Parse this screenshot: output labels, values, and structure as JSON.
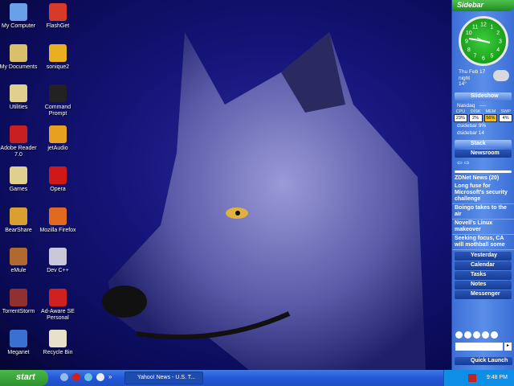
{
  "desktop": {
    "icons": [
      {
        "label": "My Computer",
        "color": "#6aa0e8"
      },
      {
        "label": "FlashGet",
        "color": "#d83a2a"
      },
      {
        "label": "My Documents",
        "color": "#d9c06a"
      },
      {
        "label": "sonique2",
        "color": "#e8b020"
      },
      {
        "label": "Utilities",
        "color": "#e0d090"
      },
      {
        "label": "Command Prompt",
        "color": "#222222"
      },
      {
        "label": "Adobe Reader 7.0",
        "color": "#c82020"
      },
      {
        "label": "jetAudio",
        "color": "#e8a020"
      },
      {
        "label": "Games",
        "color": "#e0d090"
      },
      {
        "label": "Opera",
        "color": "#d01818"
      },
      {
        "label": "BearShare",
        "color": "#d8a030"
      },
      {
        "label": "Mozilla Firefox",
        "color": "#e06a20"
      },
      {
        "label": "eMule",
        "color": "#b06a30"
      },
      {
        "label": "Dev C++",
        "color": "#c8c8d8"
      },
      {
        "label": "TorrentStorm",
        "color": "#903030"
      },
      {
        "label": "Ad-Aware SE Personal",
        "color": "#d02020"
      },
      {
        "label": "Meganet",
        "color": "#3a70d0"
      },
      {
        "label": "Recycle Bin",
        "color": "#e8e0c8"
      }
    ]
  },
  "sidebar": {
    "title": "Sidebar",
    "clock_numbers": [
      "12",
      "1",
      "2",
      "3",
      "4",
      "5",
      "6",
      "7",
      "8",
      "9",
      "10",
      "11"
    ],
    "weather": {
      "date": "Thu Feb 17",
      "period": "night",
      "temp": "14°"
    },
    "slideshow": "Slideshow",
    "stock": {
      "name": "Nasdaq",
      "value": "----"
    },
    "meters": [
      {
        "label": "CPU",
        "value": "23%"
      },
      {
        "label": "DISK",
        "value": "2%"
      },
      {
        "label": "MEM",
        "value": "56%"
      },
      {
        "label": "SWP",
        "value": "4%"
      }
    ],
    "procs": [
      "dsidebar 9%",
      "dsidebar 14"
    ],
    "stack": "Stack",
    "newsroom": "Newsroom",
    "news": [
      "ZDNet News (20)",
      "Long fuse for Microsoft's security challenge",
      "Boingo takes to the air",
      "Novell's Linux makeover",
      "Seeking focus, CA will mothball some"
    ],
    "panels": [
      "Yesterday",
      "Calendar",
      "Tasks",
      "Notes",
      "Messenger"
    ],
    "quick_launch": "Quick Launch"
  },
  "taskbar": {
    "start": "start",
    "window": "Yahoo! News - U.S. T...",
    "more": "»",
    "time": "9:48 PM"
  }
}
